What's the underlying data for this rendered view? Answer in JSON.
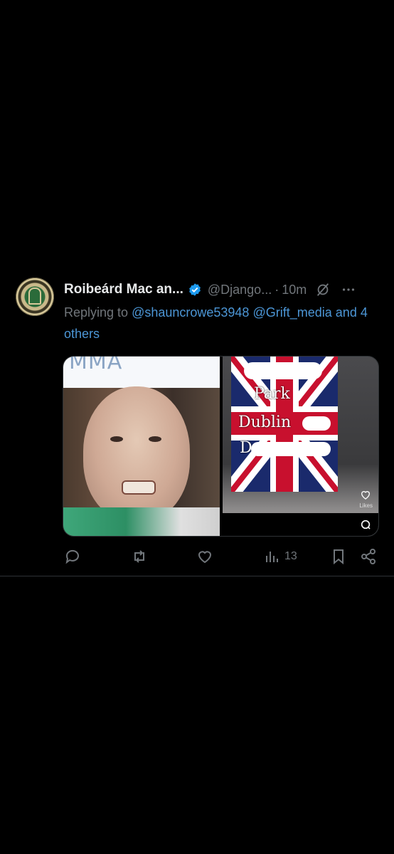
{
  "tweet": {
    "author_name": "Roibeárd Mac an...",
    "handle": "@Django...",
    "dot": "·",
    "time": "10m",
    "replying_prefix": "Replying to ",
    "reply_mentions": [
      "@shauncrowe53948",
      "@Grift_media"
    ],
    "reply_others": "and 4 others",
    "media": {
      "image1_text": "MMA",
      "image2_lines": [
        "Park",
        "Dublin",
        "D"
      ],
      "image2_likes_label": "Likes"
    },
    "actions": {
      "reply_icon": "reply-icon",
      "retweet_icon": "retweet-icon",
      "like_icon": "heart-icon",
      "views_icon": "views-icon",
      "views_count": "13",
      "bookmark_icon": "bookmark-icon",
      "share_icon": "share-icon"
    }
  },
  "colors": {
    "background": "#000000",
    "text_primary": "#e7e9ea",
    "text_secondary": "#71767b",
    "link": "#4c96d6",
    "verified": "#1d9bf0"
  }
}
